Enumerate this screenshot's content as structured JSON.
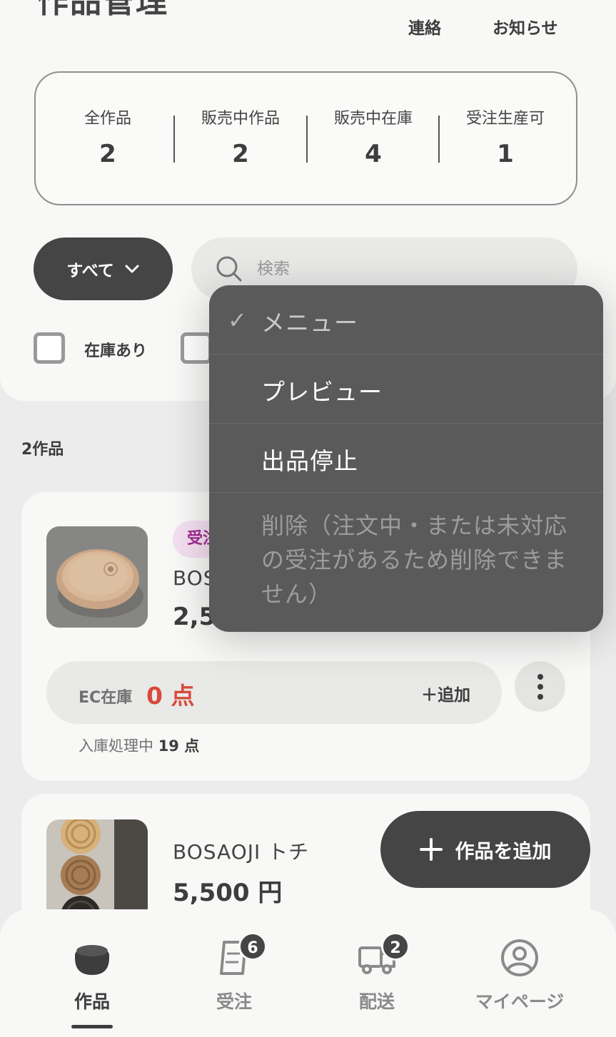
{
  "header": {
    "title": "作品管理",
    "links": [
      "連絡",
      "お知らせ"
    ]
  },
  "stats": [
    {
      "label": "全作品",
      "value": "2"
    },
    {
      "label": "販売中作品",
      "value": "2"
    },
    {
      "label": "販売中在庫",
      "value": "4"
    },
    {
      "label": "受注生産可",
      "value": "1"
    }
  ],
  "filter": {
    "label": "すべて"
  },
  "search": {
    "placeholder": "検索"
  },
  "checkboxes": [
    {
      "label": "在庫あり"
    }
  ],
  "list": {
    "count_label": "2作品"
  },
  "products": [
    {
      "badge": "受注",
      "name": "BOS",
      "price": "2,5",
      "stock_label": "EC在庫",
      "stock_value": "0 点",
      "add_label": "＋追加",
      "incoming_label": "入庫処理中",
      "incoming_value": "19 点"
    },
    {
      "name": "BOSAOJI トチ",
      "price": "5,500 円"
    }
  ],
  "fab": {
    "label": "作品を追加"
  },
  "context_menu": {
    "items": [
      {
        "label": "メニュー",
        "checked": true
      },
      {
        "label": "プレビュー"
      },
      {
        "label": "出品停止"
      },
      {
        "label": "削除（注文中・または未対応の受注があるため削除できません）",
        "disabled": true
      }
    ]
  },
  "bottom_nav": {
    "items": [
      {
        "label": "作品",
        "active": true
      },
      {
        "label": "受注",
        "badge": "6"
      },
      {
        "label": "配送",
        "badge": "2"
      },
      {
        "label": "マイページ"
      }
    ]
  }
}
